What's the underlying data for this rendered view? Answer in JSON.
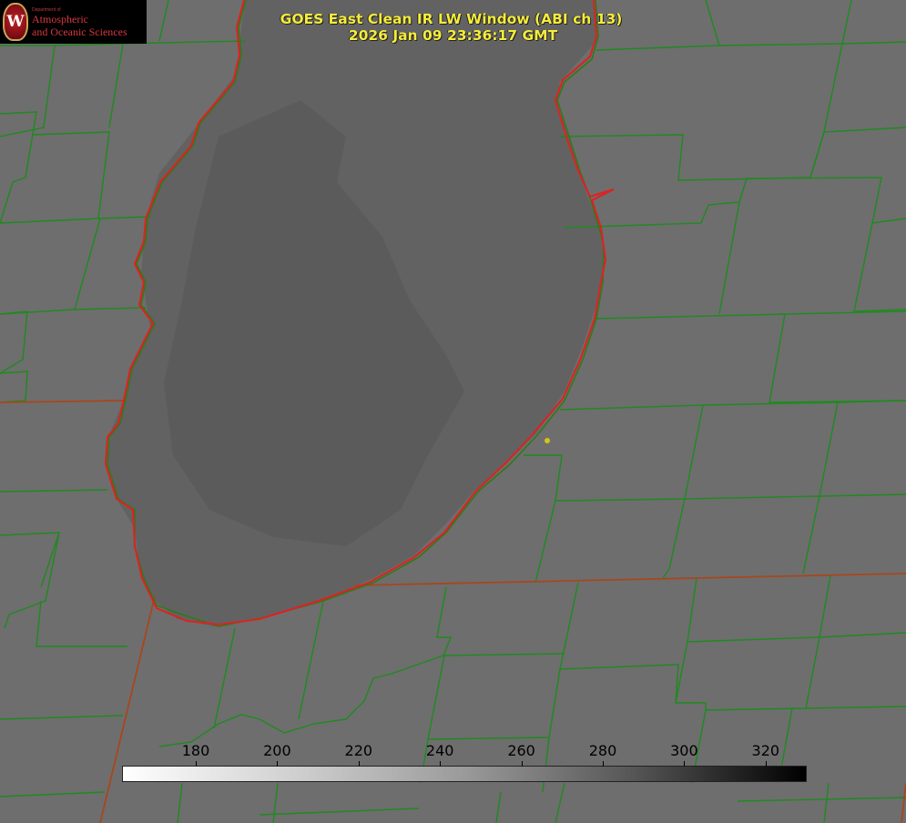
{
  "map": {
    "title_line1": "GOES East Clean IR LW Window (ABI ch 13)",
    "title_line2": "2026 Jan 09 23:36:17 GMT",
    "background_color": "#6e6e6e",
    "lake_color": "#5f5f5f",
    "county_line_color": "#1f8a1f",
    "state_line_color": "#b8401f",
    "coastline_color": "#e02020",
    "marker_color": "#d4c21a"
  },
  "logo": {
    "seal_letter": "W",
    "department": "Department of",
    "line1": "Atmospheric",
    "line2": "and Oceanic Sciences"
  },
  "colorbar": {
    "labels": [
      "180",
      "200",
      "220",
      "240",
      "260",
      "280",
      "300",
      "320"
    ]
  }
}
